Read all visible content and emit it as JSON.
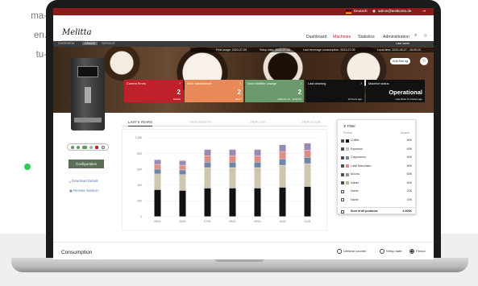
{
  "side_text": [
    "ma-",
    "en.",
    "tu-"
  ],
  "topbar": {
    "language": "Deutsch",
    "email": "admin@testkonto.de"
  },
  "brand": {
    "logo": "Melitta",
    "sub": "PROFESSIONAL"
  },
  "nav": [
    "Dashboard",
    "Machines",
    "Statistics",
    "Administration"
  ],
  "nav_active": "Machines",
  "subtabs": [
    "OVERVIEW",
    "USAGE",
    "SERVICE"
  ],
  "subtab_active": "USAGE",
  "last_week": "Last week",
  "info_strip": [
    "First usage: 2023-07-05",
    "Setup date: 2023-07-05",
    "Last beverage consumption: 2023-07-05",
    "Local time: 2023-09-27 - 15:00:10"
  ],
  "add_favorite": "Add first ag",
  "tiles": [
    {
      "title": "Current Errors",
      "value": "2",
      "sub": "Details",
      "color": "#c0202a"
    },
    {
      "title": "Next maintenance",
      "value": "2",
      "sub": "Error",
      "color": "#e88a58"
    },
    {
      "title": "Next milkfilter change",
      "value": "2",
      "sub": "2023-07-13 · 12:34:56",
      "color": "#6a9a6c"
    },
    {
      "title": "Last cleaning",
      "value": "",
      "sub": "12 hours ago",
      "color": "#111111"
    },
    {
      "title": "Machine status",
      "value": "Operational",
      "sub": "Last Data: 5 minutes ago",
      "color": "#111111"
    }
  ],
  "left_panel": {
    "config_button": "Configuration",
    "download_details": "Download Details",
    "remote_session": "Remote Session"
  },
  "period_tabs": [
    "LAST 5 YEARS",
    "PER MONTH",
    "PER DAY",
    "PER HOUR"
  ],
  "period_active": "LAST 5 YEARS",
  "chart_data": {
    "type": "bar",
    "stacked": true,
    "categories": [
      "05/01",
      "06/01",
      "07/01",
      "08/01",
      "09/01",
      "10/01",
      "11/01"
    ],
    "yticks": [
      "1.25k",
      "800",
      "600",
      "400",
      "200",
      "0"
    ],
    "ylim": [
      0,
      1000
    ],
    "grid": true,
    "series": [
      {
        "name": "Coffee",
        "color": "#111111",
        "values": [
          340,
          330,
          360,
          360,
          360,
          370,
          380
        ]
      },
      {
        "name": "Espresso",
        "color": "#cfc6b0",
        "values": [
          200,
          200,
          260,
          260,
          260,
          280,
          290
        ]
      },
      {
        "name": "Cappuccino",
        "color": "#6f86a6",
        "values": [
          60,
          60,
          70,
          70,
          70,
          80,
          80
        ]
      },
      {
        "name": "Latte Macchiato",
        "color": "#e08d86",
        "values": [
          60,
          60,
          80,
          80,
          80,
          90,
          90
        ]
      },
      {
        "name": "Mocha",
        "color": "#9c8ab6",
        "values": [
          60,
          60,
          80,
          80,
          80,
          90,
          90
        ]
      }
    ]
  },
  "filter": {
    "title": "Filter",
    "col_product": "Product",
    "col_amount": "Amount",
    "rows": [
      {
        "name": "Coffee",
        "amount": "60K",
        "checked": true,
        "color": "#111111"
      },
      {
        "name": "Espresso",
        "amount": "60K",
        "checked": true,
        "color": "#cfc6b0"
      },
      {
        "name": "Cappuccino",
        "amount": "60K",
        "checked": true,
        "color": "#6f86a6"
      },
      {
        "name": "Latte Macchiato",
        "amount": "60K",
        "checked": true,
        "color": "#e08d86"
      },
      {
        "name": "Mocha",
        "amount": "60K",
        "checked": true,
        "color": "#9c8ab6"
      },
      {
        "name": "Kakao",
        "amount": "60K",
        "checked": true,
        "color": "#c8b48a"
      },
      {
        "name": "Name",
        "amount": "20K",
        "checked": false,
        "color": "#ffffff"
      },
      {
        "name": "Name",
        "amount": "20K",
        "checked": false,
        "color": "#ffffff"
      }
    ],
    "total_label": "Sum of all products",
    "total_value": "3.400K"
  },
  "footer": {
    "title": "Consumption",
    "radios": [
      "Lifetime counter",
      "Setup date",
      "Period"
    ],
    "radio_selected": "Period"
  },
  "colors": {
    "accent": "#c0202a",
    "config_button": "#5c6f56",
    "link": "#5577aa"
  }
}
